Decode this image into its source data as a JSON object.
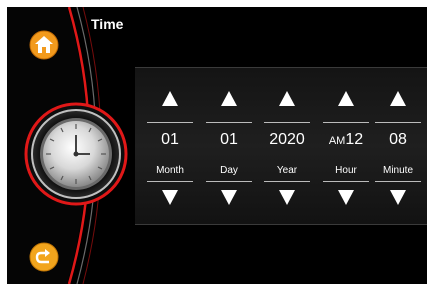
{
  "header": {
    "title": "Time"
  },
  "icons": {
    "home": "home-icon",
    "back": "back-icon",
    "clock": "clock-icon"
  },
  "colors": {
    "accent_red": "#e01818",
    "home_orange": "#f29a1d",
    "back_orange": "#f2a51d"
  },
  "fields": [
    {
      "key": "month",
      "value": "01",
      "label": "Month"
    },
    {
      "key": "day",
      "value": "01",
      "label": "Day"
    },
    {
      "key": "year",
      "value": "2020",
      "label": "Year"
    },
    {
      "key": "hour",
      "ampm": "AM",
      "value": "12",
      "label": "Hour"
    },
    {
      "key": "minute",
      "value": "08",
      "label": "Minute"
    }
  ]
}
